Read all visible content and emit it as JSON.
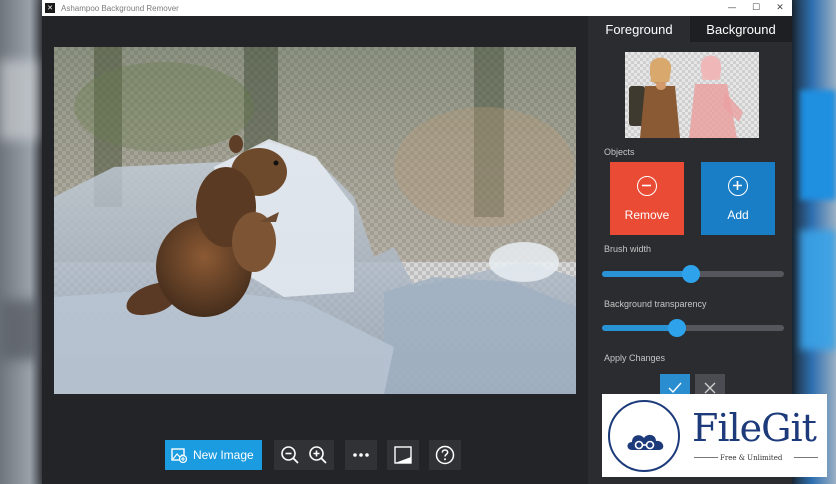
{
  "window": {
    "title": "Ashampoo Background Remover",
    "controls": [
      "—",
      "☐",
      "✕"
    ]
  },
  "toolbar": {
    "new_image_label": "New Image",
    "buttons": [
      "zoom-out",
      "zoom-in",
      "more",
      "compare",
      "help"
    ]
  },
  "panel": {
    "tabs": [
      {
        "label": "Foreground",
        "active": true
      },
      {
        "label": "Background",
        "active": false
      }
    ],
    "objects_label": "Objects",
    "remove_label": "Remove",
    "add_label": "Add",
    "brush_width_label": "Brush width",
    "brush_width_value": 0.49,
    "transparency_label": "Background transparency",
    "transparency_value": 0.41,
    "apply_label": "Apply Changes"
  },
  "watermark": {
    "name": "FileGit",
    "tagline": "Free & Unlimited"
  },
  "colors": {
    "accent": "#1b9be0",
    "remove": "#e94b35",
    "add": "#1a7ec7",
    "panel_bg": "#2b2c30",
    "window_bg": "#232427"
  }
}
